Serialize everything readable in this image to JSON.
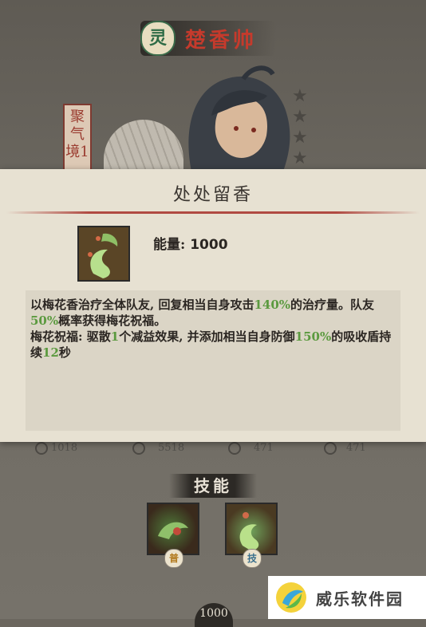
{
  "hero": {
    "badge": "灵",
    "name": "楚香帅",
    "realm": "聚气境1"
  },
  "modal": {
    "title": "处处留香",
    "energy_label": "能量:",
    "energy_value": "1000",
    "desc": {
      "line1a": "以梅花香治疗全体队友, 回复相当自身攻击",
      "pct1": "140%",
      "line1b": "的治疗量。队友",
      "pct2": "50%",
      "line1c": "概率获得梅花祝福。",
      "line2a": "梅花祝福: 驱散",
      "num1": "1",
      "line2b": "个减益效果, 并添加相当自身防御",
      "pct3": "150%",
      "line2c": "的吸收盾持续",
      "num2": "12",
      "line2d": "秒"
    },
    "accent_color": "#5b9a3f",
    "rule_color": "#b04a42"
  },
  "stats": [
    {
      "icon": "attack-icon",
      "value": "1018"
    },
    {
      "icon": "hp-icon",
      "value": "5518"
    },
    {
      "icon": "defense-icon",
      "value": "471"
    },
    {
      "icon": "speed-icon",
      "value": "471"
    }
  ],
  "skills": {
    "heading": "技能",
    "items": [
      {
        "icon": "skill-normal-icon",
        "badge": "普"
      },
      {
        "icon": "skill-special-icon",
        "badge": "技"
      }
    ]
  },
  "bottom": {
    "value": "1000"
  },
  "watermark": {
    "text": "威乐软件园"
  }
}
